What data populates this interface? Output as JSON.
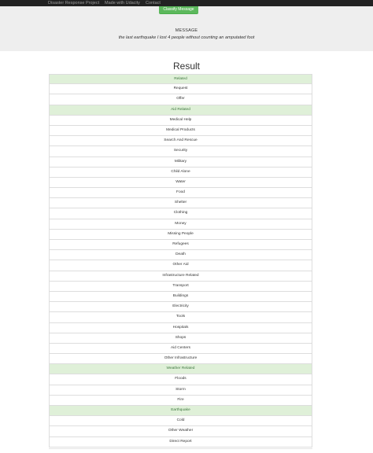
{
  "navbar": {
    "brand": "Disaster Response Project",
    "links": [
      "Made with Udacity",
      "Contact"
    ]
  },
  "jumbotron": {
    "button_label": "Classify Message",
    "message_label": "MESSAGE",
    "message_text": "the last earthquake I lost 4 people without counting an amputated foot"
  },
  "result": {
    "title": "Result",
    "categories": [
      {
        "label": "Related",
        "highlighted": true
      },
      {
        "label": "Request",
        "highlighted": false
      },
      {
        "label": "Offer",
        "highlighted": false
      },
      {
        "label": "Aid Related",
        "highlighted": true
      },
      {
        "label": "Medical Help",
        "highlighted": false
      },
      {
        "label": "Medical Products",
        "highlighted": false
      },
      {
        "label": "Search And Rescue",
        "highlighted": false
      },
      {
        "label": "Security",
        "highlighted": false
      },
      {
        "label": "Military",
        "highlighted": false
      },
      {
        "label": "Child Alone",
        "highlighted": false
      },
      {
        "label": "Water",
        "highlighted": false
      },
      {
        "label": "Food",
        "highlighted": false
      },
      {
        "label": "Shelter",
        "highlighted": false
      },
      {
        "label": "Clothing",
        "highlighted": false
      },
      {
        "label": "Money",
        "highlighted": false
      },
      {
        "label": "Missing People",
        "highlighted": false
      },
      {
        "label": "Refugees",
        "highlighted": false
      },
      {
        "label": "Death",
        "highlighted": false
      },
      {
        "label": "Other Aid",
        "highlighted": false
      },
      {
        "label": "Infrastructure Related",
        "highlighted": false
      },
      {
        "label": "Transport",
        "highlighted": false
      },
      {
        "label": "Buildings",
        "highlighted": false
      },
      {
        "label": "Electricity",
        "highlighted": false
      },
      {
        "label": "Tools",
        "highlighted": false
      },
      {
        "label": "Hospitals",
        "highlighted": false
      },
      {
        "label": "Shops",
        "highlighted": false
      },
      {
        "label": "Aid Centers",
        "highlighted": false
      },
      {
        "label": "Other Infrastructure",
        "highlighted": false
      },
      {
        "label": "Weather Related",
        "highlighted": true
      },
      {
        "label": "Floods",
        "highlighted": false
      },
      {
        "label": "Storm",
        "highlighted": false
      },
      {
        "label": "Fire",
        "highlighted": false
      },
      {
        "label": "Earthquake",
        "highlighted": true
      },
      {
        "label": "Cold",
        "highlighted": false
      },
      {
        "label": "Other Weather",
        "highlighted": false
      },
      {
        "label": "Direct Report",
        "highlighted": false
      }
    ]
  },
  "colors": {
    "navbar_bg": "#222222",
    "jumbotron_bg": "#eeeeee",
    "success_row_bg": "#dff0d8",
    "button_bg": "#5cb85c"
  }
}
